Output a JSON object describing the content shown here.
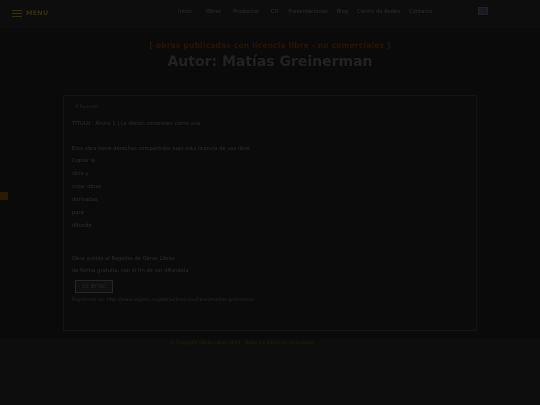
{
  "topbar": {
    "menu_label": "MENU",
    "nav": [
      "Inicio",
      "Obras",
      "Productos",
      "CD",
      "Presentaciones",
      "Blog",
      "Centro de Redes",
      "Contacto"
    ]
  },
  "header": {
    "subtitle": "[ obras publicadas con licencia libre - no comerciales ]",
    "title": "Autor: Matías Greinerman"
  },
  "card": {
    "heading": "A Ransom",
    "line1": "TÍTULO · Ahora 1 | Le dieron corazones como una",
    "line2": "Esta obra tiene derechos compartidos bajo esta licencia de uso libre",
    "list": [
      "Copiar la",
      "obra y",
      "crear obras",
      "derivadas",
      "para",
      "difundir"
    ],
    "line3": "Obra subida al Registro de Obras Libres",
    "line4": "de forma gratuita, con el fin de ser difundida",
    "cc_label": "CC BY-NC",
    "footer_line": "Registrada en: http://www.registro.org/obras/licencias/libres/matias-greinerman"
  },
  "footer": {
    "text": "© Copyright Obras Libres 2014 · Todos los derechos reservados"
  }
}
